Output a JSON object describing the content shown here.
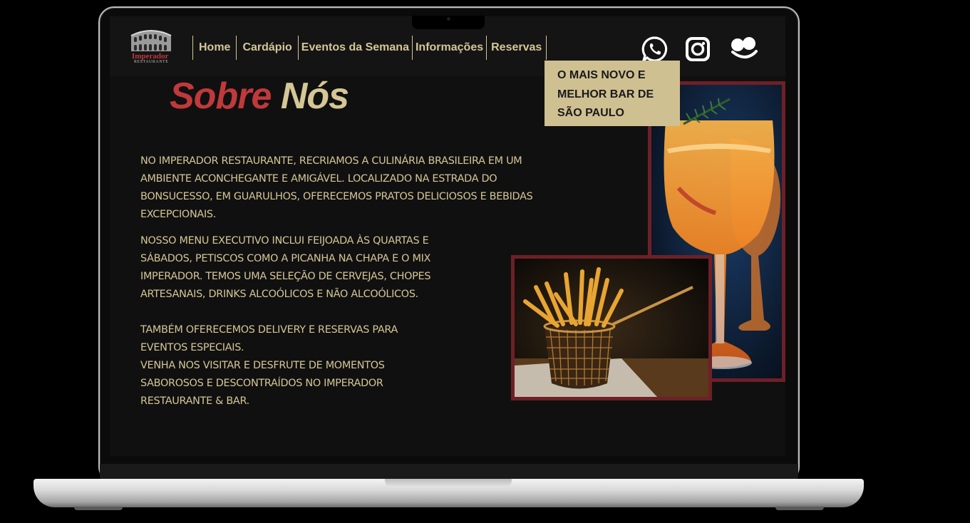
{
  "logo": {
    "name": "Imperador",
    "subtitle": "RESTAURANTE"
  },
  "nav": [
    {
      "label": "Home"
    },
    {
      "label": "Cardápio"
    },
    {
      "label": "Eventos da Semana"
    },
    {
      "label": "Informações"
    },
    {
      "label": "Reservas"
    }
  ],
  "social": [
    "whatsapp-icon",
    "instagram-icon",
    "ifood-icon"
  ],
  "section": {
    "title_part1": "Sobre",
    "title_part2": "Nós",
    "paragraph1_lines": [
      "NO IMPERADOR RESTAURANTE, RECRIAMOS A CULINÁRIA BRASILEIRA EM UM",
      "AMBIENTE ACONCHEGANTE E AMIGÁVEL. LOCALIZADO NA ESTRADA DO",
      "BONSUCESSO, EM GUARULHOS, OFERECEMOS PRATOS DELICIOSOS E BEBIDAS",
      "EXCEPCIONAIS."
    ],
    "paragraph2_lines": [
      "NOSSO MENU EXECUTIVO INCLUI FEIJOADA ÀS QUARTAS E",
      "SÁBADOS, PETISCOS COMO A PICANHA NA CHAPA E O MIX",
      "IMPERADOR. TEMOS UMA SELEÇÃO DE CERVEJAS, CHOPES",
      "ARTESANAIS, DRINKS ALCOÓLICOS E NÃO ALCOÓLICOS."
    ],
    "paragraph3_lines": [
      "TAMBÉM OFERECEMOS DELIVERY E RESERVAS PARA",
      "EVENTOS ESPECIAIS.",
      "VENHA NOS VISITAR E DESFRUTE DE MOMENTOS",
      "SABOROSOS E DESCONTRAÍDOS NO IMPERADOR",
      "RESTAURANTE & BAR."
    ],
    "badge_lines": [
      "O MAIS NOVO E",
      "MELHOR BAR DE",
      "SÃO PAULO"
    ]
  },
  "colors": {
    "accent_red": "#c0393b",
    "gold": "#d5c696",
    "badge_bg": "#cfc092",
    "frame": "#6e2027",
    "background": "#101010"
  }
}
